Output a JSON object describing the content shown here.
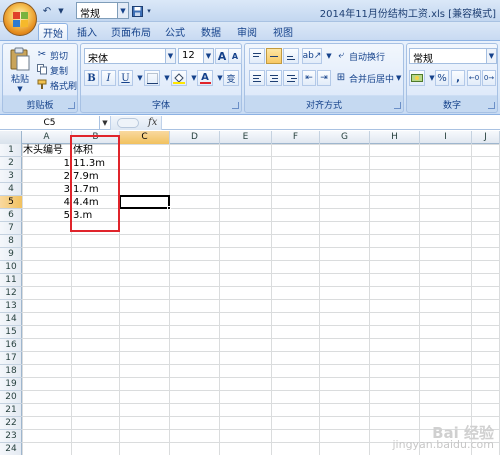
{
  "titlebar": {
    "style_value": "常规",
    "doc_title": "2014年11月份结构工资.xls [兼容模式]"
  },
  "tabs": [
    "开始",
    "插入",
    "页面布局",
    "公式",
    "数据",
    "审阅",
    "视图"
  ],
  "ribbon": {
    "clipboard": {
      "paste": "粘贴",
      "cut": "剪切",
      "copy": "复制",
      "format_painter": "格式刷",
      "label": "剪贴板"
    },
    "font": {
      "font_name": "宋体",
      "font_size": "12",
      "bold": "B",
      "italic": "I",
      "underline": "U",
      "grow": "A",
      "shrink": "A",
      "wen": "变",
      "font_color": "A",
      "label": "字体"
    },
    "alignment": {
      "wrap_text": "自动换行",
      "merge_center": "合并后居中",
      "label": "对齐方式"
    },
    "number": {
      "format": "常规",
      "percent": "%",
      "comma": ",",
      "label": "数字"
    }
  },
  "formula_bar": {
    "name_box": "C5",
    "fx": "fx",
    "formula": ""
  },
  "columns": [
    "A",
    "B",
    "C",
    "D",
    "E",
    "F",
    "G",
    "H",
    "I",
    "J"
  ],
  "rows": [
    "1",
    "2",
    "3",
    "4",
    "5",
    "6",
    "7",
    "8",
    "9",
    "10",
    "11",
    "12",
    "13",
    "14",
    "15",
    "16",
    "17",
    "18",
    "19",
    "20",
    "21",
    "22",
    "23",
    "24"
  ],
  "active_cell": "C5",
  "cells": {
    "A1": "木头编号",
    "B1": "体积",
    "A2": "1",
    "B2": "11.3m",
    "A3": "2",
    "B3": "7.9m",
    "A4": "3",
    "B4": "1.7m",
    "A5": "4",
    "B5": "4.4m",
    "A6": "5",
    "B6": "3.m"
  },
  "watermark": {
    "line1": "Bai 经验",
    "line2": "jingyan.baidu.com"
  },
  "colors": {
    "selection_outline": "#e0242b",
    "header_active": "#f1c15f"
  }
}
